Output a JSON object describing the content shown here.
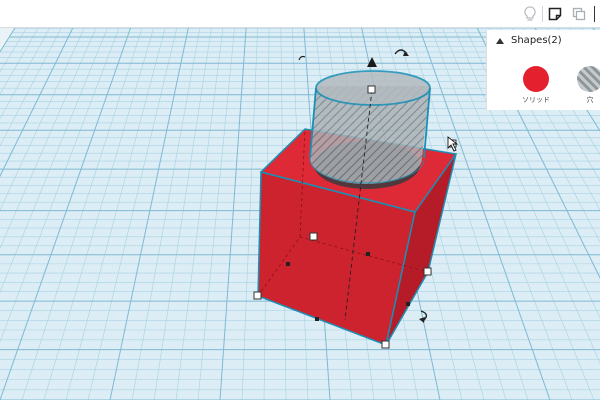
{
  "inspector": {
    "title": "Shapes(2)",
    "solid": {
      "label": "ソリッド",
      "color": "#e4202e"
    },
    "hole": {
      "label": "穴"
    }
  },
  "icons": {
    "toolbar": [
      "lightbulb-icon",
      "note-icon",
      "copy-icon"
    ],
    "collapse": "triangle-up-icon"
  },
  "colors": {
    "grid_bg": "#dcedf5",
    "grid_line": "#9fcde0",
    "box_front": "#c8202d",
    "box_right": "#b11a26",
    "box_top": "#e02a36",
    "hole": "#9aa3a8",
    "selection": "#1a8fb5"
  }
}
